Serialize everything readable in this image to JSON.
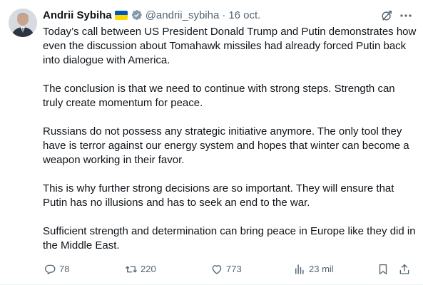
{
  "author": {
    "name": "Andrii Sybiha",
    "handle": "@andrii_sybiha",
    "separator": "·",
    "date": "16 oct."
  },
  "icons": {
    "flag": "ukraine-flag-icon",
    "verified": "verified-badge-icon",
    "grok": "grok-icon",
    "more": "more-icon",
    "reply": "reply-icon",
    "retweet": "retweet-icon",
    "like": "like-icon",
    "views": "views-icon",
    "bookmark": "bookmark-icon",
    "share": "share-icon"
  },
  "colors": {
    "text": "#0f1419",
    "muted": "#536471",
    "verified": "#829aab",
    "flag_blue": "#0057b7",
    "flag_yellow": "#ffd700"
  },
  "tweet": {
    "paragraphs": [
      "Today’s call between US President Donald Trump and Putin demonstrates how even the discussion about Tomahawk missiles had already forced Putin back into dialogue with America.",
      "The conclusion is that we need to continue with strong steps. Strength can truly create momentum for peace.",
      "Russians do not possess any strategic initiative anymore. The only tool they have is terror against our energy system and hopes that winter can become a weapon working in their favor.",
      "This is why further strong decisions are so important. They will ensure that Putin has no illusions and has to seek an end to the war.",
      "Sufficient strength and determination can bring peace in Europe like they did in the Middle East."
    ]
  },
  "metrics": {
    "replies": "78",
    "retweets": "220",
    "likes": "773",
    "views": "23 mil"
  }
}
